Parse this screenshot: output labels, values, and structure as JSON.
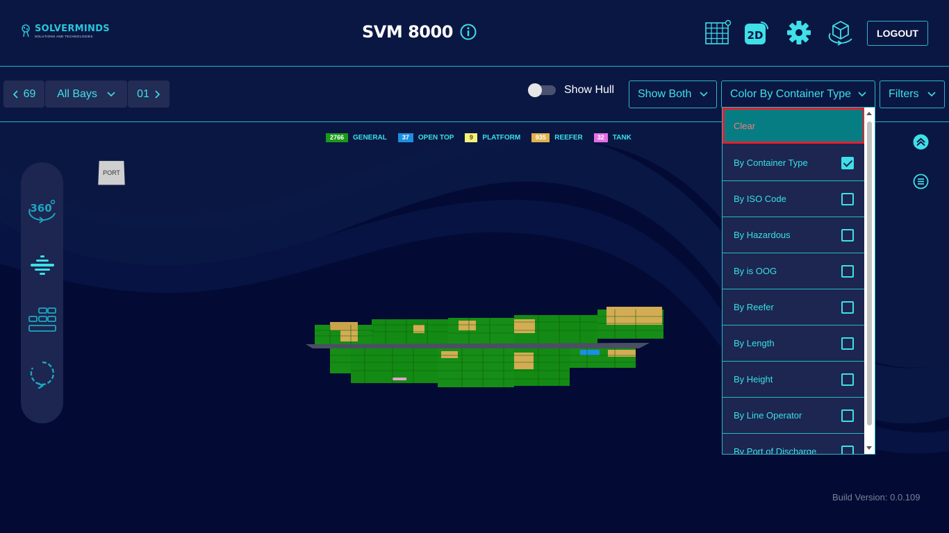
{
  "header": {
    "logo": {
      "name": "SOLVERMINDS",
      "tagline": "SOLUTIONS AND TECHNOLOGIES"
    },
    "title": "SVM 8000",
    "icons": [
      "grid-view-icon",
      "2d-view-icon",
      "settings-gear-icon",
      "3d-cube-icon"
    ],
    "view_2d_label": "2D",
    "logout_label": "LOGOUT"
  },
  "toolbar": {
    "bay_prev": "69",
    "bay_select": "All Bays",
    "bay_next": "01",
    "show_hull_label": "Show Hull",
    "show_hull_on": false,
    "show_both_label": "Show Both",
    "color_by_label": "Color By Container Type",
    "filters_label": "Filters"
  },
  "legend": [
    {
      "count": "2766",
      "label": "GENERAL",
      "color": "#1a9a1a"
    },
    {
      "count": "37",
      "label": "OPEN TOP",
      "color": "#1b8fe0"
    },
    {
      "count": "9",
      "label": "PLATFORM",
      "color": "#f4f27a"
    },
    {
      "count": "935",
      "label": "REEFER",
      "color": "#e2b34a"
    },
    {
      "count": "32",
      "label": "TANK",
      "color": "#e66ee6"
    }
  ],
  "scene": {
    "port_label": "PORT",
    "side_tools": [
      "rotate-360-icon",
      "layers-icon",
      "container-stack-icon",
      "reset-view-icon"
    ]
  },
  "color_menu": {
    "items": [
      {
        "label": "Clear",
        "checked": null
      },
      {
        "label": "By Container Type",
        "checked": true
      },
      {
        "label": "By ISO Code",
        "checked": false
      },
      {
        "label": "By Hazardous",
        "checked": false
      },
      {
        "label": "By is OOG",
        "checked": false
      },
      {
        "label": "By Reefer",
        "checked": false
      },
      {
        "label": "By Length",
        "checked": false
      },
      {
        "label": "By Height",
        "checked": false
      },
      {
        "label": "By Line Operator",
        "checked": false
      },
      {
        "label": "By Port of Discharge",
        "checked": false
      }
    ]
  },
  "footer": {
    "build_version": "Build Version: 0.0.109"
  },
  "colors": {
    "accent": "#3fe0e8",
    "header_bg": "#0b1743",
    "scene_bg": "#030b34",
    "clear_bg": "#067d82",
    "highlight": "#e5202e"
  }
}
